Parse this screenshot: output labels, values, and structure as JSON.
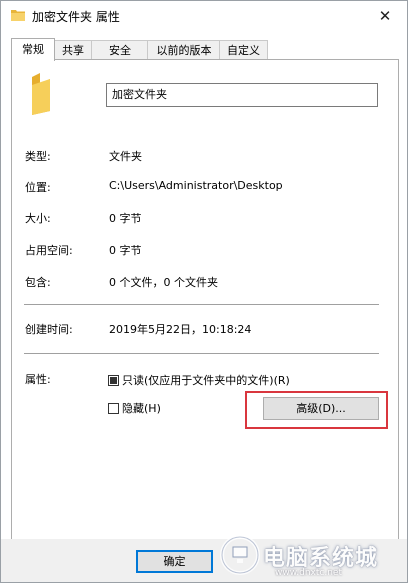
{
  "window": {
    "title": "加密文件夹 属性",
    "close_glyph": "✕"
  },
  "tabs": [
    {
      "label": "常规",
      "active": true
    },
    {
      "label": "共享"
    },
    {
      "label": "安全"
    },
    {
      "label": "以前的版本"
    },
    {
      "label": "自定义"
    }
  ],
  "general": {
    "name_value": "加密文件夹",
    "rows": [
      {
        "label": "类型:",
        "value": "文件夹"
      },
      {
        "label": "位置:",
        "value": "C:\\Users\\Administrator\\Desktop"
      },
      {
        "label": "大小:",
        "value": "0 字节"
      },
      {
        "label": "占用空间:",
        "value": "0 字节"
      },
      {
        "label": "包含:",
        "value": "0 个文件，0 个文件夹"
      }
    ],
    "created_label": "创建时间:",
    "created_value": "2019年5月22日，10:18:24",
    "attributes_label": "属性:",
    "readonly_label": "只读(仅应用于文件夹中的文件)(R)",
    "readonly_state": "indeterminate",
    "hidden_label": "隐藏(H)",
    "hidden_state": "unchecked",
    "advanced_button": "高级(D)..."
  },
  "footer": {
    "ok_label": "确定"
  },
  "watermark": {
    "text": "电脑系统城",
    "url": "www.dnxtc.net"
  },
  "colors": {
    "folder": "#f2c84b",
    "highlight": "#d9363e",
    "default_button_border": "#0078d7"
  }
}
